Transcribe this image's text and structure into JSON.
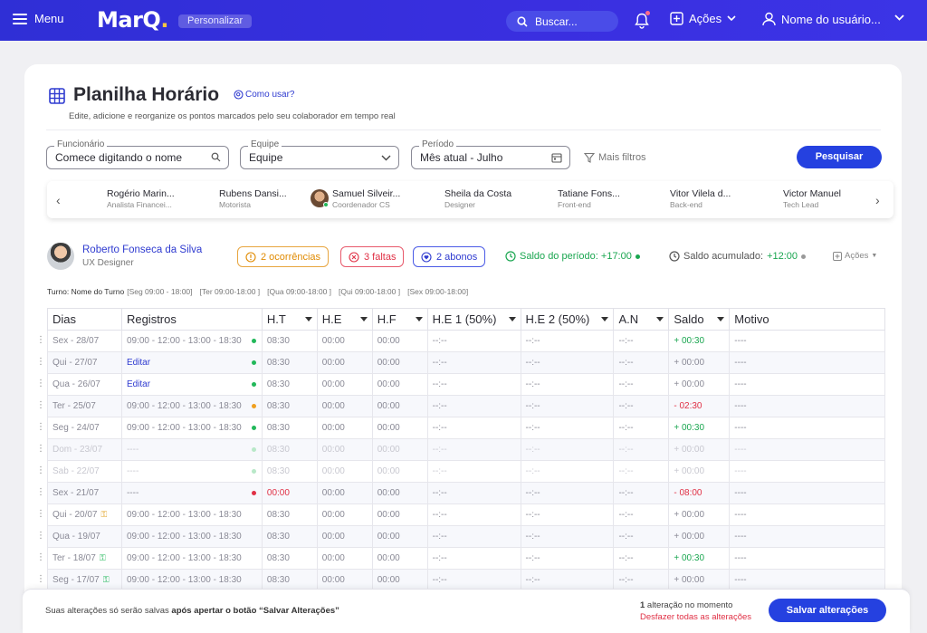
{
  "nav": {
    "menu_label": "Menu",
    "logo_text": "MarQ",
    "logo_dot": ".",
    "personalizar_label": "Personalizar",
    "search_label": "Buscar...",
    "acoes_label": "Ações",
    "user_label": "Nome do usuário..."
  },
  "page": {
    "title": "Planilha Horário",
    "help_link": "Como usar?",
    "subtitle": "Edite, adicione e reorganize os pontos marcados pelo seu colaborador em tempo real"
  },
  "filters": {
    "funcionario_label": "Funcionário",
    "funcionario_placeholder": "Comece digitando o nome",
    "equipe_label": "Equipe",
    "equipe_value": "Equipe",
    "periodo_label": "Período",
    "periodo_value": "Mês atual - Julho",
    "mais_filtros": "Mais filtros",
    "pesquisar": "Pesquisar"
  },
  "employees": [
    {
      "name": "Rogério Marin...",
      "role": "Analista Financei..."
    },
    {
      "name": "Rubens Dansi...",
      "role": "Motorista"
    },
    {
      "name": "Samuel Silveir...",
      "role": "Coordenador CS"
    },
    {
      "name": "Sheila da Costa",
      "role": "Designer"
    },
    {
      "name": "Tatiane Fons...",
      "role": "Front-end"
    },
    {
      "name": "Vitor Vilela d...",
      "role": "Back-end"
    },
    {
      "name": "Victor Manuel",
      "role": "Tech Lead"
    }
  ],
  "selected": {
    "name": "Roberto Fonseca da Silva",
    "role": "UX Designer",
    "ocorrencias": "2 ocorrências",
    "faltas": "3 faltas",
    "abonos": "2 abonos",
    "saldo_periodo": "Saldo do período: +17:00",
    "saldo_acumulado_label": "Saldo acumulado:",
    "saldo_acumulado_value": "+12:00",
    "acoes": "Ações"
  },
  "turno": {
    "label": "Turno: Nome do Turno",
    "days": [
      "[Seg 09:00 - 18:00]",
      "[Ter 09:00-18:00 ]",
      "[Qua 09:00-18:00 ]",
      "[Qui 09:00-18:00 ]",
      "[Sex 09:00-18:00]"
    ]
  },
  "table": {
    "headers": [
      "Dias",
      "Registros",
      "H.T",
      "H.E",
      "H.F",
      "H.E 1 (50%)",
      "H.E 2 (50%)",
      "A.N",
      "Saldo",
      "Motivo"
    ],
    "rows": [
      {
        "dia": "Sex - 28/07",
        "reg": "09:00 - 12:00 - 13:00 - 18:30",
        "ht": "08:30",
        "he": "00:00",
        "hf": "00:00",
        "he1": "--:--",
        "he2": "--:--",
        "an": "--:--",
        "saldo": "+ 00:30",
        "motivo": "----"
      },
      {
        "dia": "Qui - 27/07",
        "reg": "Editar",
        "ht": "08:30",
        "he": "00:00",
        "hf": "00:00",
        "he1": "--:--",
        "he2": "--:--",
        "an": "--:--",
        "saldo": "+ 00:00",
        "motivo": "----"
      },
      {
        "dia": "Qua - 26/07",
        "reg": "Editar",
        "ht": "08:30",
        "he": "00:00",
        "hf": "00:00",
        "he1": "--:--",
        "he2": "--:--",
        "an": "--:--",
        "saldo": "+ 00:00",
        "motivo": "----"
      },
      {
        "dia": "Ter - 25/07",
        "reg": "09:00 - 12:00 - 13:00 - 18:30",
        "ht": "08:30",
        "he": "00:00",
        "hf": "00:00",
        "he1": "--:--",
        "he2": "--:--",
        "an": "--:--",
        "saldo": "- 02:30",
        "motivo": "----"
      },
      {
        "dia": "Seg - 24/07",
        "reg": "09:00 - 12:00 - 13:00 - 18:30",
        "ht": "08:30",
        "he": "00:00",
        "hf": "00:00",
        "he1": "--:--",
        "he2": "--:--",
        "an": "--:--",
        "saldo": "+ 00:30",
        "motivo": "----"
      },
      {
        "dia": "Dom - 23/07",
        "reg": "----",
        "ht": "08:30",
        "he": "00:00",
        "hf": "00:00",
        "he1": "--:--",
        "he2": "--:--",
        "an": "--:--",
        "saldo": "+ 00:00",
        "motivo": "----"
      },
      {
        "dia": "Sab - 22/07",
        "reg": "----",
        "ht": "08:30",
        "he": "00:00",
        "hf": "00:00",
        "he1": "--:--",
        "he2": "--:--",
        "an": "--:--",
        "saldo": "+ 00:00",
        "motivo": "----"
      },
      {
        "dia": "Sex - 21/07",
        "reg": "----",
        "ht": "00:00",
        "he": "00:00",
        "hf": "00:00",
        "he1": "--:--",
        "he2": "--:--",
        "an": "--:--",
        "saldo": "- 08:00",
        "motivo": "----"
      },
      {
        "dia": "Qui - 20/07",
        "reg": "09:00 - 12:00 - 13:00 - 18:30",
        "ht": "08:30",
        "he": "00:00",
        "hf": "00:00",
        "he1": "--:--",
        "he2": "--:--",
        "an": "--:--",
        "saldo": "+ 00:00",
        "motivo": "----"
      },
      {
        "dia": "Qua - 19/07",
        "reg": "09:00 - 12:00 - 13:00 - 18:30",
        "ht": "08:30",
        "he": "00:00",
        "hf": "00:00",
        "he1": "--:--",
        "he2": "--:--",
        "an": "--:--",
        "saldo": "+ 00:00",
        "motivo": "----"
      },
      {
        "dia": "Ter - 18/07",
        "reg": "09:00 - 12:00 - 13:00 - 18:30",
        "ht": "08:30",
        "he": "00:00",
        "hf": "00:00",
        "he1": "--:--",
        "he2": "--:--",
        "an": "--:--",
        "saldo": "+ 00:30",
        "motivo": "----"
      },
      {
        "dia": "Seg - 17/07",
        "reg": "09:00 - 12:00 - 13:00 - 18:30",
        "ht": "08:30",
        "he": "00:00",
        "hf": "00:00",
        "he1": "--:--",
        "he2": "--:--",
        "an": "--:--",
        "saldo": "+ 00:00",
        "motivo": "----"
      }
    ]
  },
  "bottom": {
    "note_prefix": "Suas alterações só serão salvas ",
    "note_bold": "após apertar o botão “Salvar Alterações”",
    "count_bold": "1",
    "count_text": " alteração no momento",
    "undo": "Desfazer todas as alterações",
    "save": "Salvar alterações"
  },
  "colors": {
    "brand": "#2f2fd6",
    "primary_button": "#2541e0",
    "positive": "#1aa650",
    "negative": "#e03045",
    "warning": "#e08a00"
  }
}
